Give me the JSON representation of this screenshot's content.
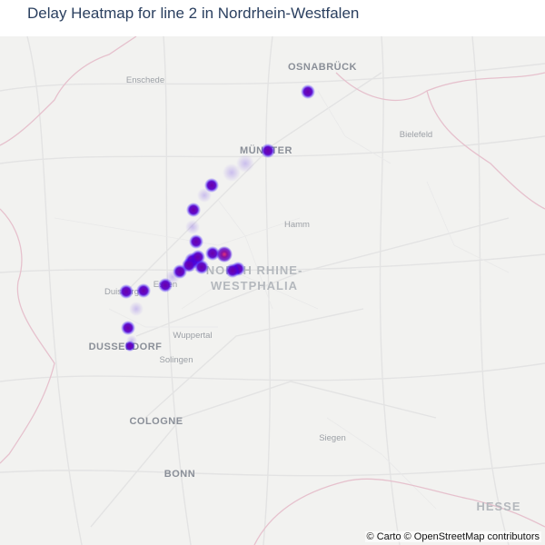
{
  "title": "Delay Heatmap for line 2 in Nordrhein-Westfalen",
  "attribution": "© Carto © OpenStreetMap contributors",
  "colors": {
    "background": "#f2f2f0",
    "road": "#e4e4e4",
    "border": "#e9c3cf",
    "city_major": "#8a8f98",
    "city_minor": "#9ca0a6",
    "heat_core": "#6a00a8",
    "heat_outer": "#1f00ff",
    "heat_hot": "#e0347a",
    "title": "#2a3f5f"
  },
  "places": [
    {
      "id": "osnabrueck",
      "label": "OSNABRÜCK",
      "kind": "major"
    },
    {
      "id": "enschede",
      "label": "Enschede",
      "kind": "minor"
    },
    {
      "id": "muenster",
      "label": "MÜNSTER",
      "kind": "major"
    },
    {
      "id": "bielefeld",
      "label": "Bielefeld",
      "kind": "minor"
    },
    {
      "id": "hamm",
      "label": "Hamm",
      "kind": "minor"
    },
    {
      "id": "nrw1",
      "label": "NORTH RHINE-",
      "kind": "region"
    },
    {
      "id": "nrw2",
      "label": "WESTPHALIA",
      "kind": "region"
    },
    {
      "id": "duisburg",
      "label": "Duisburg",
      "kind": "minor"
    },
    {
      "id": "essen",
      "label": "Essen",
      "kind": "minor"
    },
    {
      "id": "wuppertal",
      "label": "Wuppertal",
      "kind": "minor"
    },
    {
      "id": "duesseldorf",
      "label": "DUSSELDORF",
      "kind": "major"
    },
    {
      "id": "solingen",
      "label": "Solingen",
      "kind": "minor"
    },
    {
      "id": "cologne",
      "label": "COLOGNE",
      "kind": "major"
    },
    {
      "id": "siegen",
      "label": "Siegen",
      "kind": "minor"
    },
    {
      "id": "bonn",
      "label": "BONN",
      "kind": "major"
    },
    {
      "id": "hesse",
      "label": "HESSE",
      "kind": "region"
    }
  ]
}
